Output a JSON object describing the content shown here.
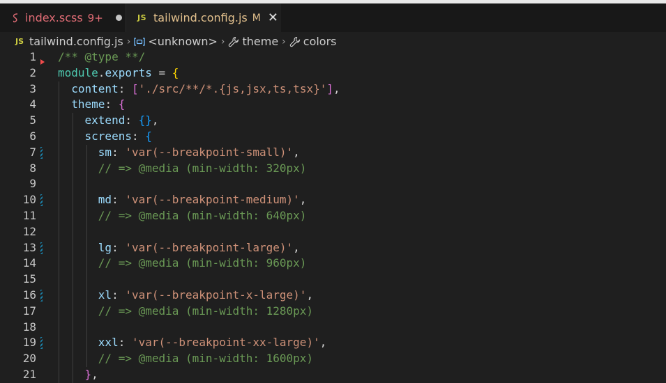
{
  "tabs": [
    {
      "name": "index.scss",
      "problems": "9+",
      "state": "dirty"
    },
    {
      "name": "tailwind.config.js",
      "badge": "M",
      "close": "✕"
    }
  ],
  "breadcrumb": {
    "file": "tailwind.config.js",
    "items": [
      "<unknown>",
      "theme",
      "colors"
    ],
    "file_icon": "JS",
    "separator": "›"
  },
  "editor": {
    "lines": [
      {
        "n": "1",
        "text": "/** @type **/"
      },
      {
        "n": "2",
        "text": "module.exports = {"
      },
      {
        "n": "3",
        "text": "  content: ['./src/**/*.{js,jsx,ts,tsx}'],"
      },
      {
        "n": "4",
        "text": "  theme: {"
      },
      {
        "n": "5",
        "text": "    extend: {},"
      },
      {
        "n": "6",
        "text": "    screens: {"
      },
      {
        "n": "7",
        "text": "      sm: 'var(--breakpoint-small)',"
      },
      {
        "n": "8",
        "text": "      // => @media (min-width: 320px)"
      },
      {
        "n": "9",
        "text": ""
      },
      {
        "n": "10",
        "text": "      md: 'var(--breakpoint-medium)',"
      },
      {
        "n": "11",
        "text": "      // => @media (min-width: 640px)"
      },
      {
        "n": "12",
        "text": ""
      },
      {
        "n": "13",
        "text": "      lg: 'var(--breakpoint-large)',"
      },
      {
        "n": "14",
        "text": "      // => @media (min-width: 960px)"
      },
      {
        "n": "15",
        "text": ""
      },
      {
        "n": "16",
        "text": "      xl: 'var(--breakpoint-x-large)',"
      },
      {
        "n": "17",
        "text": "      // => @media (min-width: 1280px)"
      },
      {
        "n": "18",
        "text": ""
      },
      {
        "n": "19",
        "text": "      xxl: 'var(--breakpoint-xx-large)',"
      },
      {
        "n": "20",
        "text": "      // => @media (min-width: 1600px)"
      },
      {
        "n": "21",
        "text": "    },"
      }
    ],
    "modified_lines": [
      "7",
      "10",
      "13",
      "16",
      "19"
    ],
    "deleted_after_line": "1"
  },
  "colors": {
    "comment": "#6a9955",
    "string": "#ce9178",
    "property": "#9cdcfe",
    "keyword": "#4ec9b0",
    "brace1": "#ffd700",
    "brace2": "#da70d6",
    "brace3": "#179fff",
    "error": "#e06c75",
    "modified": "#e2c08d"
  }
}
